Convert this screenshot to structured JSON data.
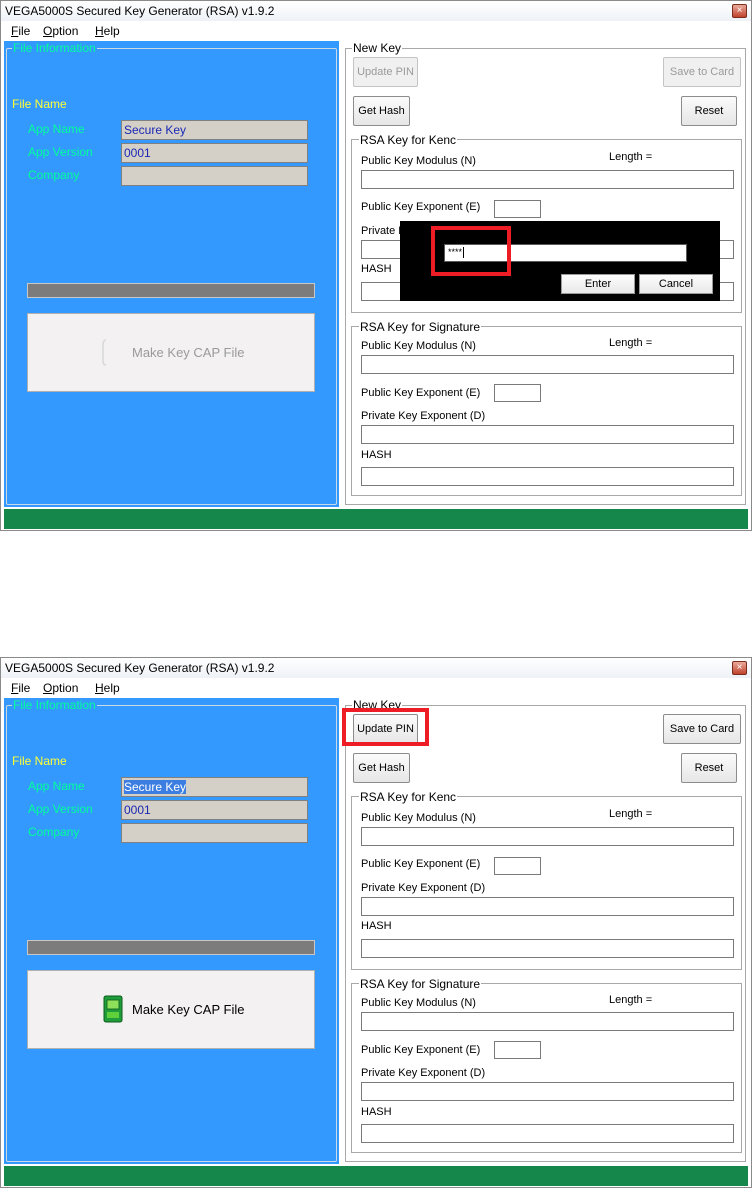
{
  "window": {
    "title": "VEGA5000S Secured Key Generator (RSA) v1.9.2",
    "close_glyph": "×"
  },
  "menu": [
    {
      "label": "File",
      "accel": "F",
      "rest": "ile"
    },
    {
      "label": "Option",
      "accel": "O",
      "rest": "ption"
    },
    {
      "label": "Help",
      "accel": "H",
      "rest": "elp"
    }
  ],
  "file_info": {
    "legend": "File Information",
    "file_name_label": "File Name",
    "app_name_label": "App Name",
    "app_version_label": "App Version",
    "company_label": "Company",
    "app_name_value": "Secure Key",
    "app_version_value": "0001",
    "company_value": "",
    "make_button_label": "Make Key CAP File"
  },
  "new_key": {
    "legend": "New Key",
    "update_pin_label": "Update PIN",
    "save_to_card_label": "Save to Card",
    "get_hash_label": "Get Hash",
    "reset_label": "Reset"
  },
  "kenc": {
    "legend": "RSA Key for Kenc",
    "modulus_label": "Public Key Modulus (N)",
    "length_label": "Length =",
    "exponent_e_label": "Public Key Exponent (E)",
    "exponent_d_label": "Private Key Exponent (D)",
    "hash_label": "HASH",
    "private_label_partial": "Private K"
  },
  "sig": {
    "legend": "RSA Key for Signature",
    "modulus_label": "Public Key Modulus (N)",
    "length_label": "Length =",
    "exponent_e_label": "Public Key Exponent (E)",
    "exponent_d_label": "Private Key Exponent (D)",
    "hash_label": "HASH"
  },
  "pin_dialog": {
    "input_value": "****",
    "enter_label": "Enter",
    "cancel_label": "Cancel"
  },
  "colors": {
    "left_panel": "#3399ff",
    "label_green": "#00ff99",
    "file_name_yellow": "#ffff33",
    "status_bar": "#15874a",
    "highlight": "#ee1c25"
  },
  "icons": {
    "close": "close-icon",
    "cap_file": "cap-file-icon"
  }
}
